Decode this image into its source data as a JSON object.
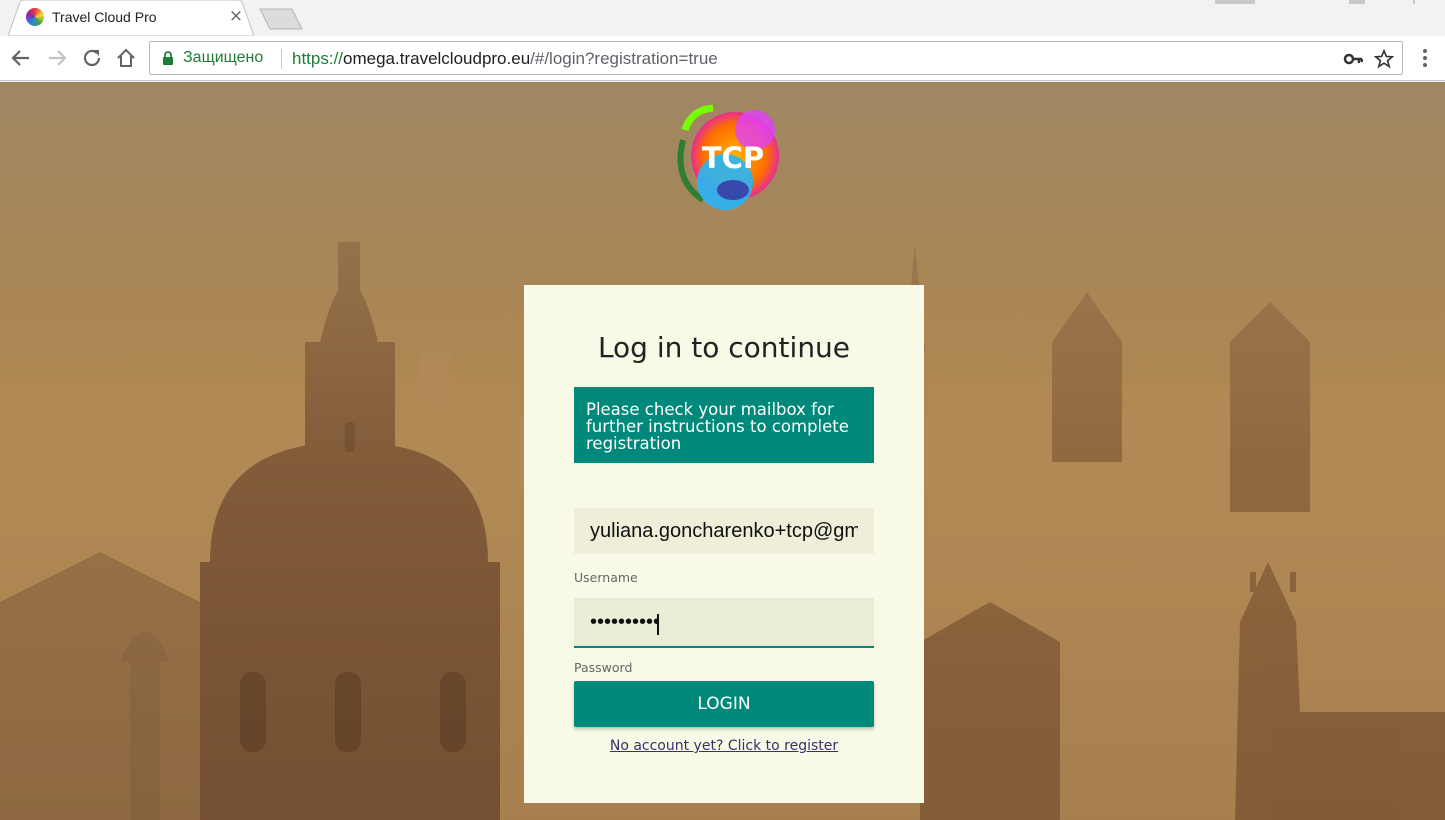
{
  "browser": {
    "tab_title": "Travel Cloud Pro",
    "tab_close": "×",
    "secure_label": "Защищено",
    "url_scheme": "https://",
    "url_host": "omega.travelcloudpro.eu",
    "url_path": "/#/login?registration=true"
  },
  "login": {
    "logo_text": "TCP",
    "title": "Log in to continue",
    "notice_lines": [
      "Please check your mailbox for",
      "further instructions to complete",
      "registration"
    ],
    "username_label": "Username",
    "username_value": "yuliana.goncharenko+tcp@gm",
    "password_label": "Password",
    "password_value": "••••••••••",
    "login_button": "LOGIN",
    "register_link": "No account yet? Click to register"
  },
  "colors": {
    "accent": "#00897b",
    "card_background": "#f8f9e6",
    "secure_green": "#1e7e34"
  },
  "icons": {
    "back": "arrow-left-icon",
    "forward": "arrow-right-icon",
    "reload": "reload-icon",
    "home": "home-icon",
    "lock": "lock-icon",
    "key": "key-icon",
    "bookmark": "star-icon",
    "menu": "kebab-menu-icon"
  }
}
